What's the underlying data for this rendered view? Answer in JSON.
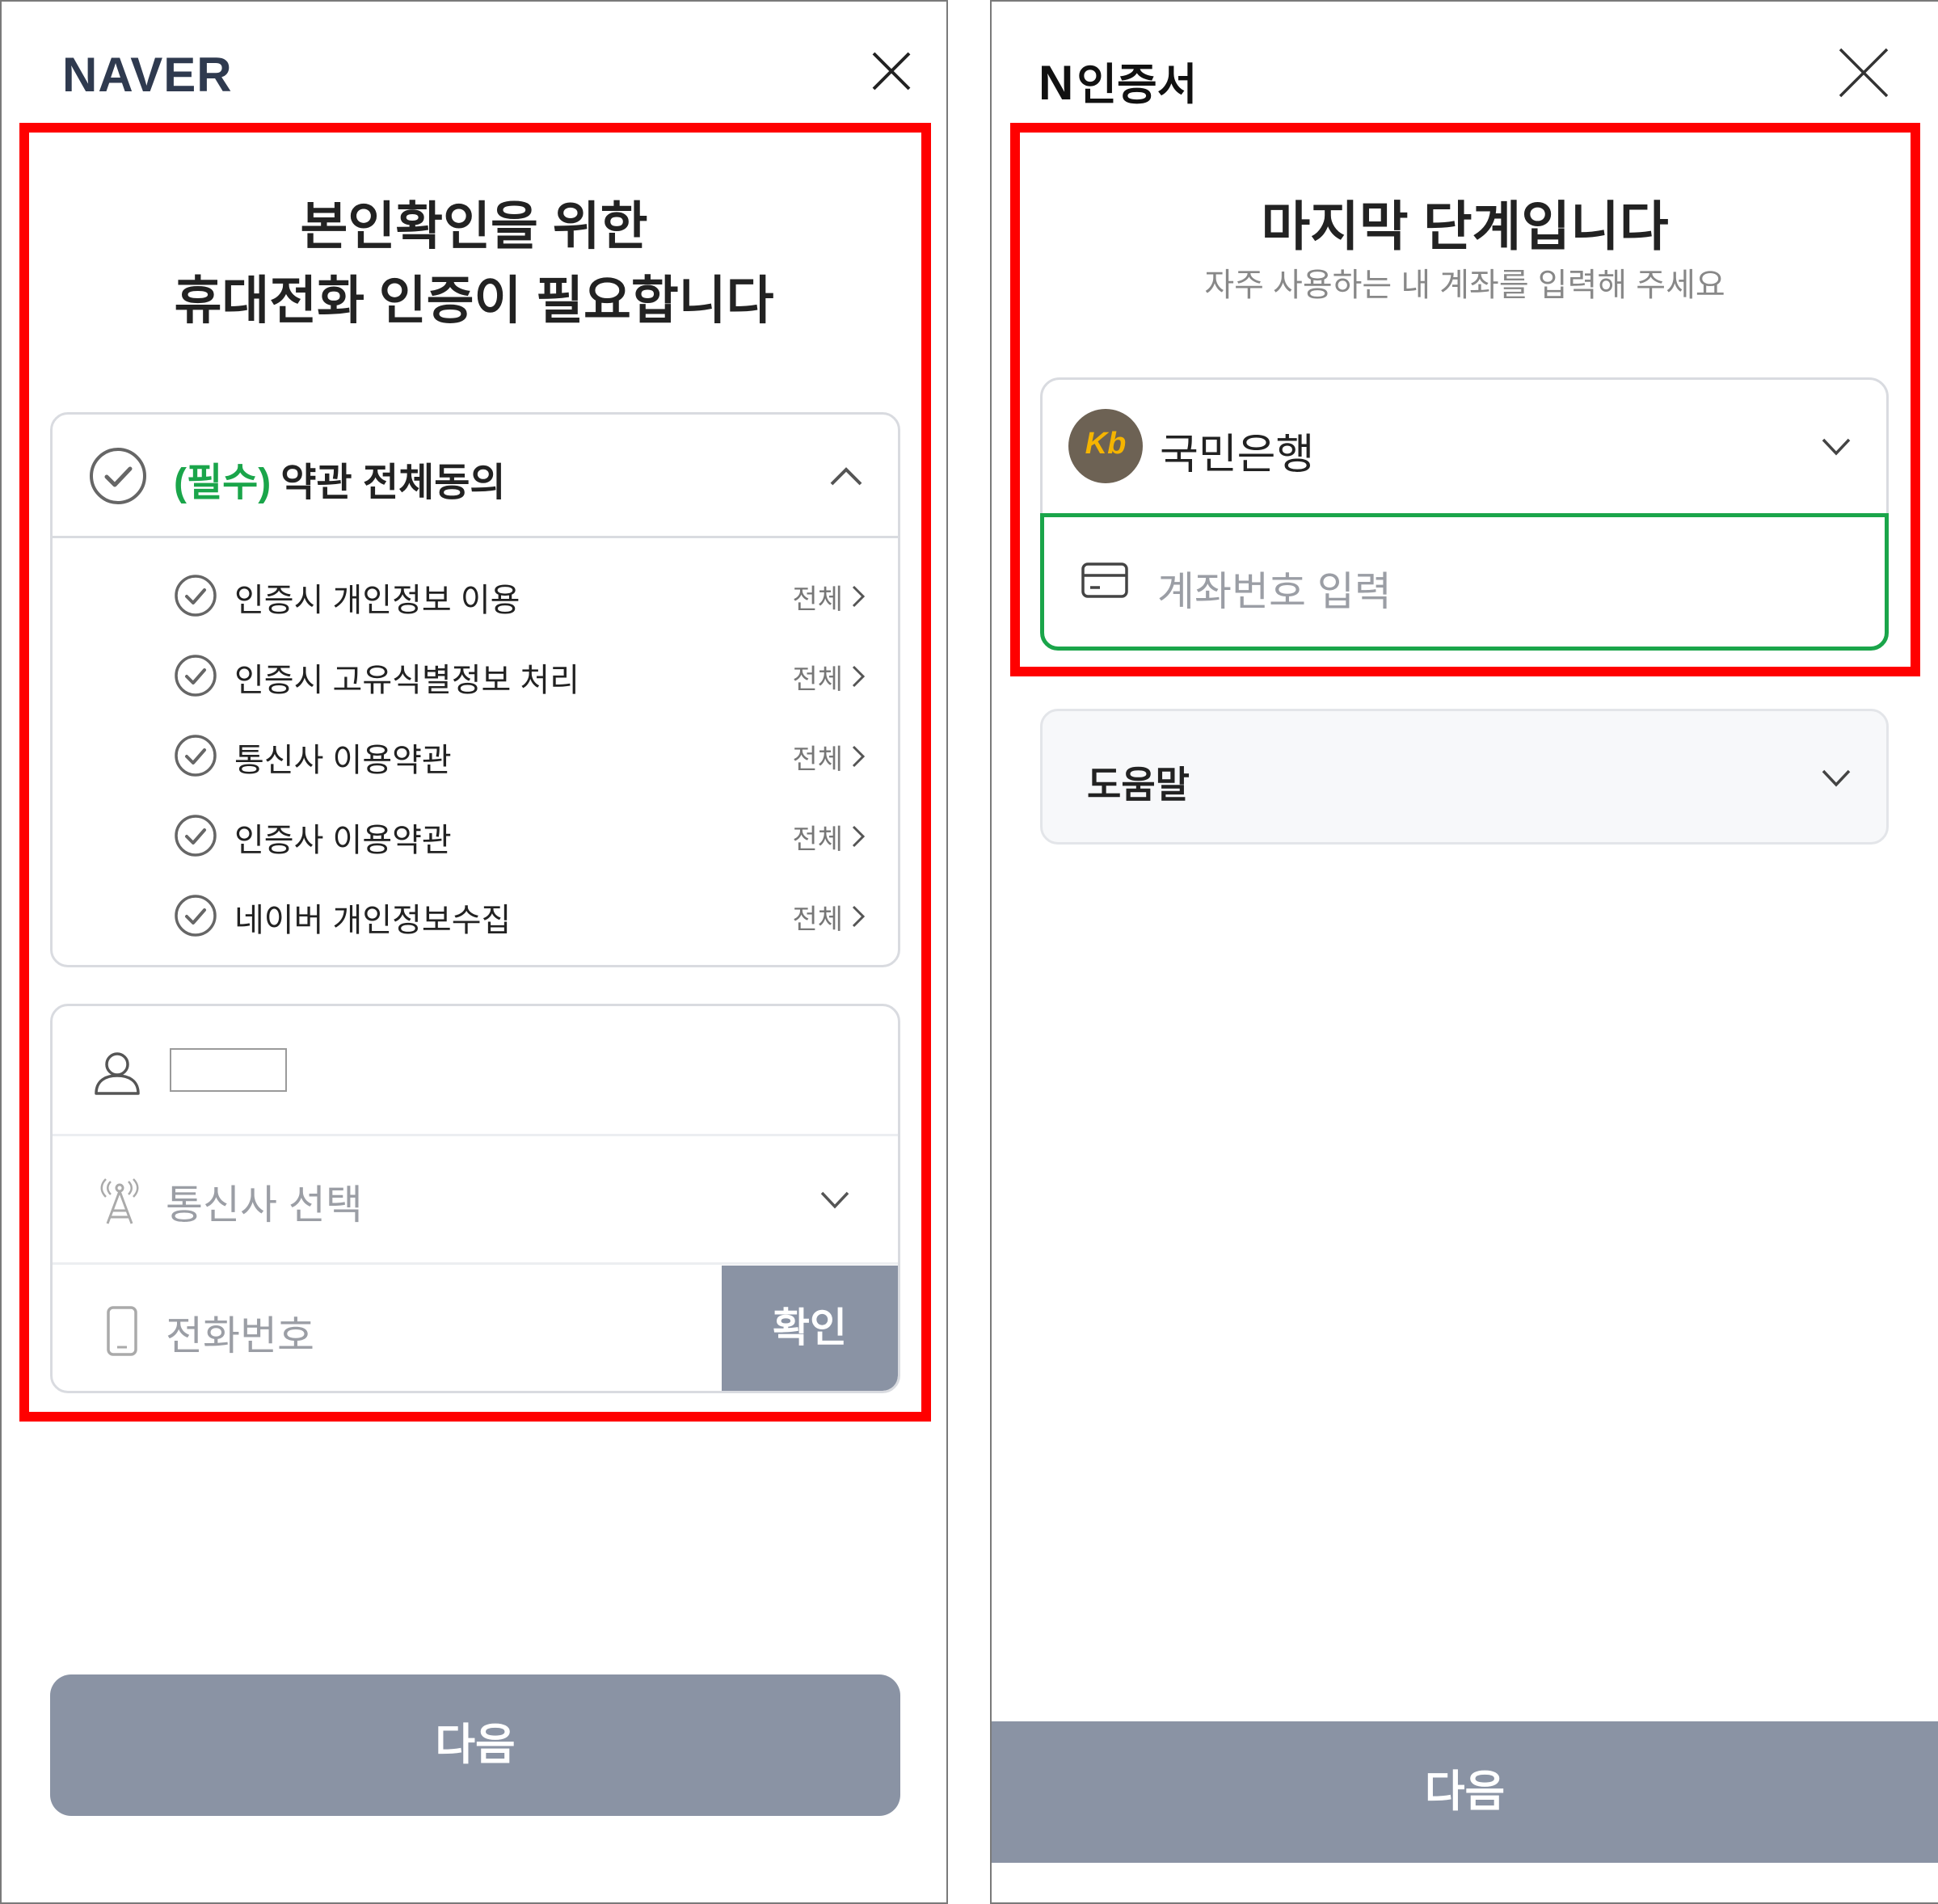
{
  "left": {
    "brand": "NAVER",
    "title_line1": "본인확인을 위한",
    "title_line2": "휴대전화 인증이 필요합니다",
    "agree_all": {
      "required_tag": "(필수)",
      "label": "약관 전체동의"
    },
    "terms": [
      {
        "label": "인증시 개인정보 이용",
        "link": "전체"
      },
      {
        "label": "인증시 고유식별정보 처리",
        "link": "전체"
      },
      {
        "label": "통신사 이용약관",
        "link": "전체"
      },
      {
        "label": "인증사 이용약관",
        "link": "전체"
      },
      {
        "label": "네이버 개인정보수집",
        "link": "전체"
      }
    ],
    "form": {
      "name_value": "",
      "carrier_placeholder": "통신사 선택",
      "phone_placeholder": "전화번호",
      "confirm_label": "확인"
    },
    "next_label": "다음"
  },
  "right": {
    "brand_n": "N",
    "brand_text": "인증서",
    "title": "마지막 단계입니다",
    "subtitle": "자주 사용하는 내 계좌를 입력해 주세요",
    "bank_name": "국민은행",
    "bank_logo_text": "Kb",
    "account_placeholder": "계좌번호 입력",
    "help_label": "도움말",
    "next_label": "다음"
  },
  "colors": {
    "accent_green": "#1aa54a",
    "button_gray": "#8a93a4",
    "highlight_red": "#ff0000",
    "bank_logo_bg": "#6d6254",
    "bank_logo_fg": "#f5b400"
  },
  "icons": [
    "close-icon",
    "check-circle-icon",
    "chevron-up-icon",
    "chevron-right-icon",
    "person-icon",
    "antenna-icon",
    "chevron-down-icon",
    "phone-icon",
    "bank-logo",
    "card-icon"
  ]
}
